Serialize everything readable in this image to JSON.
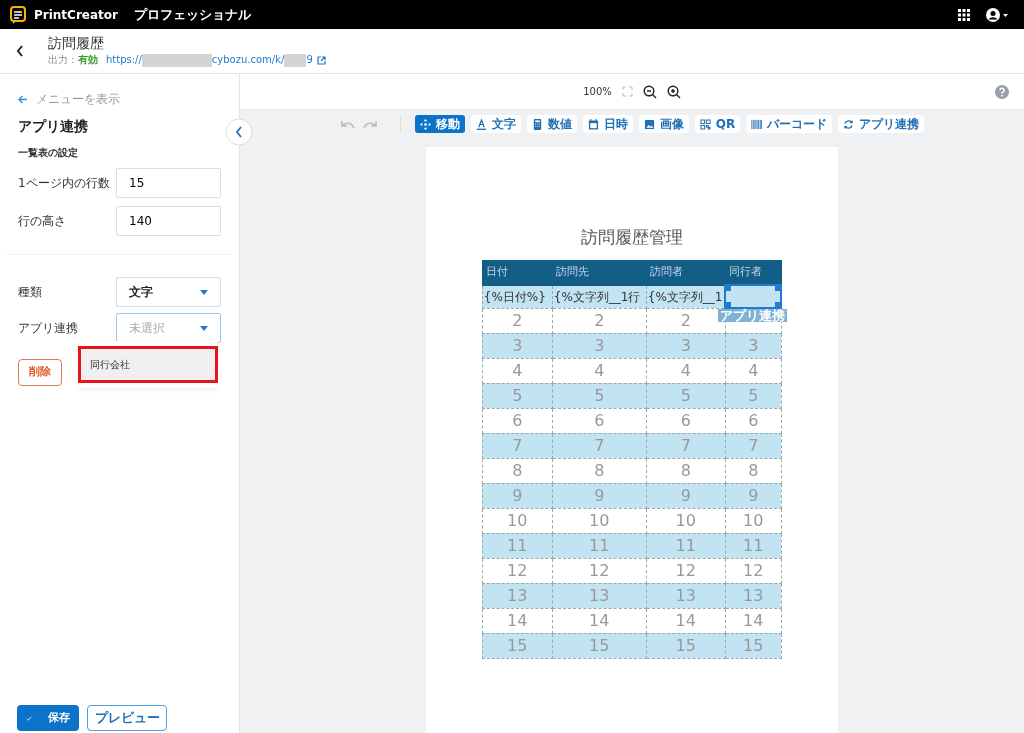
{
  "app": {
    "name": "PrintCreator",
    "edition": "プロフェッショナル"
  },
  "header": {
    "title": "訪問履歴",
    "output_label": "出力：",
    "output_status": "有効",
    "url_parts": [
      "https://",
      "cybozu.com/k/",
      "9"
    ]
  },
  "sidebar": {
    "back_link": "メニューを表示",
    "title": "アプリ連携",
    "section": "一覧表の設定",
    "fields": [
      {
        "label": "1ページ内の行数",
        "value": "15"
      },
      {
        "label": "行の高さ",
        "value": "140"
      }
    ],
    "selects": [
      {
        "label": "種類",
        "value": "文字"
      },
      {
        "label": "アプリ連携",
        "placeholder": "未選択",
        "open": true
      }
    ],
    "dropdown_options": [
      {
        "label": "同行会社",
        "hovered": true,
        "annotated": true
      }
    ],
    "delete_button": "削除",
    "save_button": "保存",
    "preview_button": "プレビュー"
  },
  "zoom": {
    "level": "100%"
  },
  "tools": [
    {
      "kind": "move",
      "label": "移動",
      "selected": true
    },
    {
      "kind": "text",
      "label": "文字",
      "selected": false
    },
    {
      "kind": "number",
      "label": "数値",
      "selected": false
    },
    {
      "kind": "date",
      "label": "日時",
      "selected": false
    },
    {
      "kind": "image",
      "label": "画像",
      "selected": false
    },
    {
      "kind": "qr",
      "label": "QR",
      "selected": false
    },
    {
      "kind": "barcode",
      "label": "バーコード",
      "selected": false
    },
    {
      "kind": "link",
      "label": "アプリ連携",
      "selected": false
    }
  ],
  "page": {
    "title": "訪問履歴管理",
    "columns": [
      "日付",
      "訪問先",
      "訪問者",
      "同行者"
    ],
    "first_row": [
      "{%日付%}",
      "{%文字列__1行",
      "{%文字列__1"
    ],
    "selected_cell_label": "アプリ連携",
    "rows": [
      [
        "2",
        "2",
        "2"
      ],
      [
        "3",
        "3",
        "3",
        "3"
      ],
      [
        "4",
        "4",
        "4",
        "4"
      ],
      [
        "5",
        "5",
        "5",
        "5"
      ],
      [
        "6",
        "6",
        "6",
        "6"
      ],
      [
        "7",
        "7",
        "7",
        "7"
      ],
      [
        "8",
        "8",
        "8",
        "8"
      ],
      [
        "9",
        "9",
        "9",
        "9"
      ],
      [
        "10",
        "10",
        "10",
        "10"
      ],
      [
        "11",
        "11",
        "11",
        "11"
      ],
      [
        "12",
        "12",
        "12",
        "12"
      ],
      [
        "13",
        "13",
        "13",
        "13"
      ],
      [
        "14",
        "14",
        "14",
        "14"
      ],
      [
        "15",
        "15",
        "15",
        "15"
      ]
    ]
  }
}
